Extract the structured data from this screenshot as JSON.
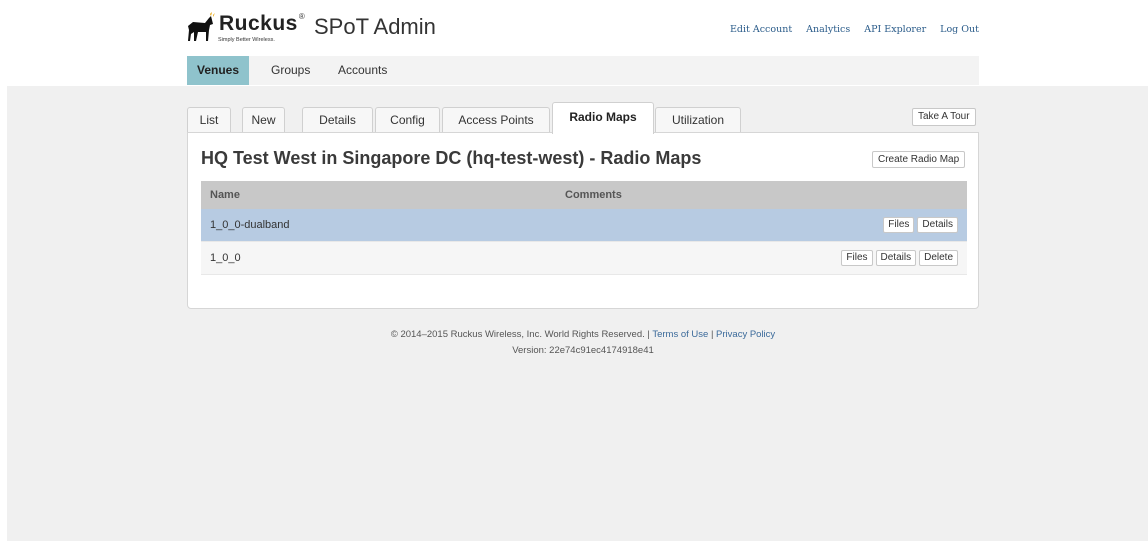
{
  "brand": {
    "name": "Ruckus",
    "tagline": "Simply Better Wireless.",
    "app_title": "SPoT Admin"
  },
  "top_links": {
    "edit_account": "Edit Account",
    "analytics": "Analytics",
    "api_explorer": "API Explorer",
    "log_out": "Log Out"
  },
  "main_nav": {
    "venues": "Venues",
    "groups": "Groups",
    "accounts": "Accounts",
    "active": "Venues"
  },
  "tabs": {
    "list": "List",
    "new": "New",
    "details": "Details",
    "config": "Config",
    "access_points": "Access Points",
    "radio_maps": "Radio Maps",
    "utilization": "Utilization",
    "active": "Radio Maps"
  },
  "take_tour": "Take A Tour",
  "page_title": "HQ Test West in Singapore DC (hq-test-west) - Radio Maps",
  "create_radio_map": "Create Radio Map",
  "table": {
    "headers": {
      "name": "Name",
      "comments": "Comments"
    },
    "rows": [
      {
        "name": "1_0_0-dualband",
        "comments": "",
        "files": "Files",
        "details": "Details"
      },
      {
        "name": "1_0_0",
        "comments": "",
        "files": "Files",
        "details": "Details",
        "delete": "Delete"
      }
    ]
  },
  "footer": {
    "copyright": "© 2014–2015 Ruckus Wireless, Inc. World Rights Reserved. |",
    "terms": "Terms of Use",
    "separator": "|",
    "privacy": "Privacy Policy",
    "version": "Version: 22e74c91ec4174918e41"
  },
  "colors": {
    "active_nav": "#8fc3cc",
    "selected_row": "#b7cbe2",
    "link": "#2b5c8a",
    "content_bg": "#f0f0f0"
  }
}
